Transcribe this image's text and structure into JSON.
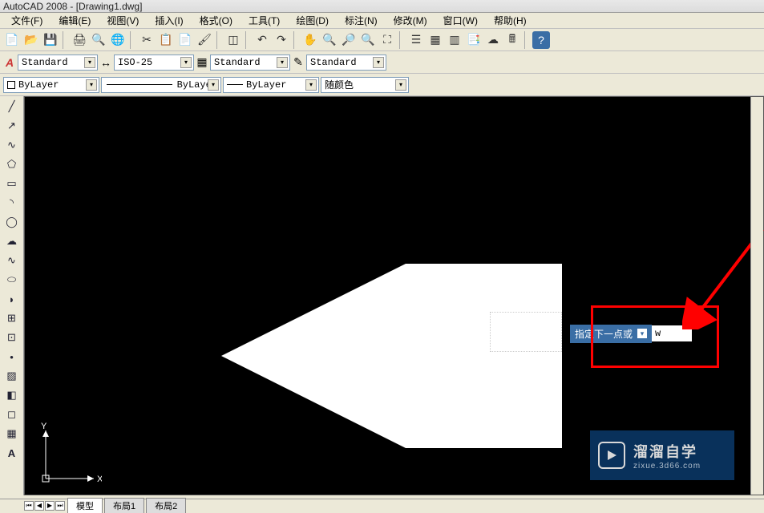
{
  "window": {
    "title": "AutoCAD 2008 - [Drawing1.dwg]"
  },
  "menu": {
    "items": [
      "文件(F)",
      "编辑(E)",
      "视图(V)",
      "插入(I)",
      "格式(O)",
      "工具(T)",
      "绘图(D)",
      "标注(N)",
      "修改(M)",
      "窗口(W)",
      "帮助(H)"
    ]
  },
  "toolbar_std": {
    "text_style": "Standard",
    "dim_style": "ISO-25",
    "table_style": "Standard",
    "mleader_style": "Standard"
  },
  "toolbar_layer": {
    "layer": "ByLayer",
    "linetype": "ByLayer",
    "lineweight": "ByLayer",
    "color": "随颜色"
  },
  "dyn_prompt": {
    "label": "指定下一点或",
    "input": "w"
  },
  "ucs": {
    "x": "X",
    "y": "Y"
  },
  "tabs": {
    "model": "模型",
    "layout1": "布局1",
    "layout2": "布局2"
  },
  "watermark": {
    "title": "溜溜自学",
    "url": "zixue.3d66.com"
  }
}
